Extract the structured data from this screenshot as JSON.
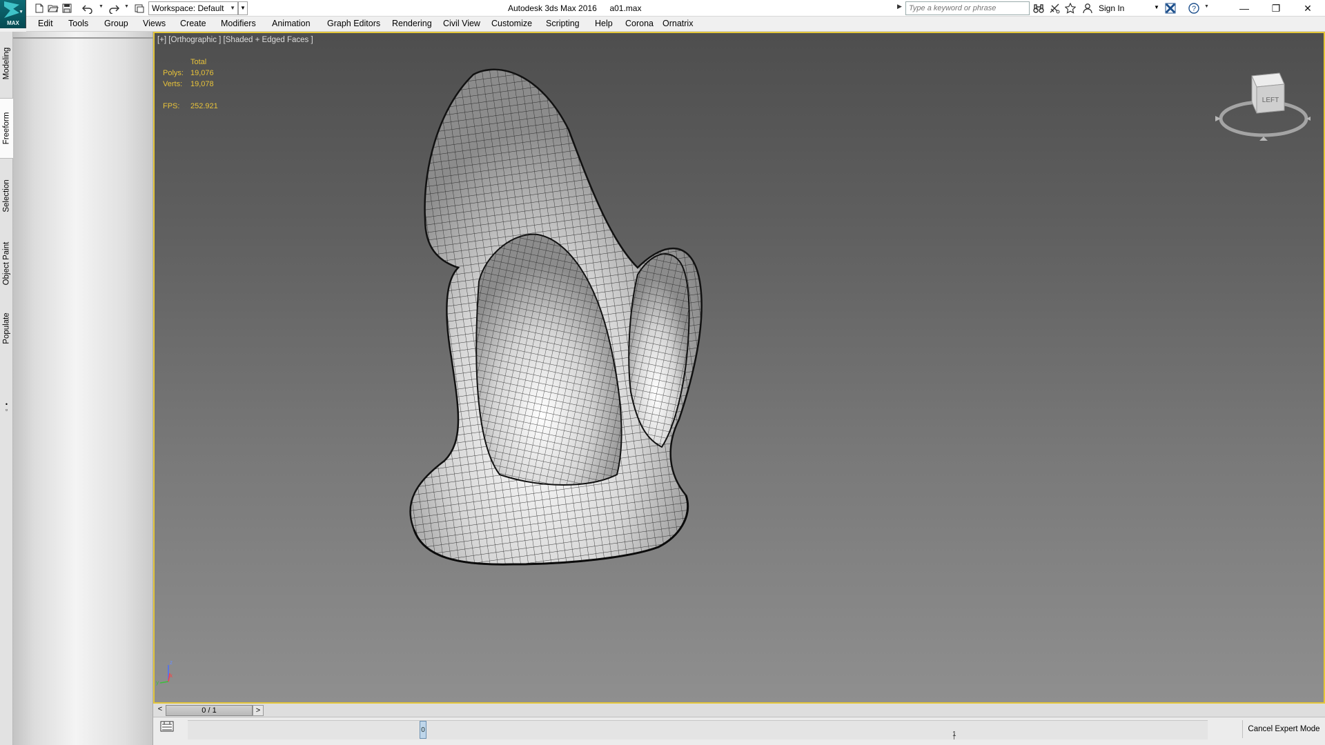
{
  "titlebar": {
    "app_logo_text": "MAX",
    "workspace_label": "Workspace: Default",
    "app_title": "Autodesk 3ds Max 2016",
    "file_name": "a01.max",
    "search_placeholder": "Type a keyword or phrase",
    "sign_in": "Sign In",
    "icons": [
      "new-file-icon",
      "open-folder-icon",
      "save-icon",
      "undo-icon",
      "redo-icon",
      "project-folder-icon",
      "binoculars-icon",
      "communication-center-icon",
      "favorites-star-icon",
      "user-icon",
      "exchange-apps-icon",
      "help-icon"
    ]
  },
  "menubar": {
    "items": [
      "Edit",
      "Tools",
      "Group",
      "Views",
      "Create",
      "Modifiers",
      "Animation",
      "Graph Editors",
      "Rendering",
      "Civil View",
      "Customize",
      "Scripting",
      "Help",
      "Corona",
      "Ornatrix"
    ]
  },
  "ribbon": {
    "tabs": [
      "Modeling",
      "Freeform",
      "Selection",
      "Object Paint",
      "Populate"
    ],
    "active_tab": "Freeform"
  },
  "viewport": {
    "label": "[+] [Orthographic ] [Shaded + Edged Faces ]",
    "stats": {
      "header": "Total",
      "polys_label": "Polys:",
      "polys_value": "19,076",
      "verts_label": "Verts:",
      "verts_value": "19,078",
      "fps_label": "FPS:",
      "fps_value": "252.921"
    },
    "viewcube_face": "LEFT",
    "axis_labels": {
      "z": "z",
      "y": "y",
      "x": "x"
    },
    "border_color": "#e5c73a"
  },
  "timeline": {
    "prev": "<",
    "slider_text": "0 / 1",
    "next": ">",
    "key_marker": "0",
    "frame_label": "1",
    "cancel_expert_mode": "Cancel Expert Mode"
  }
}
